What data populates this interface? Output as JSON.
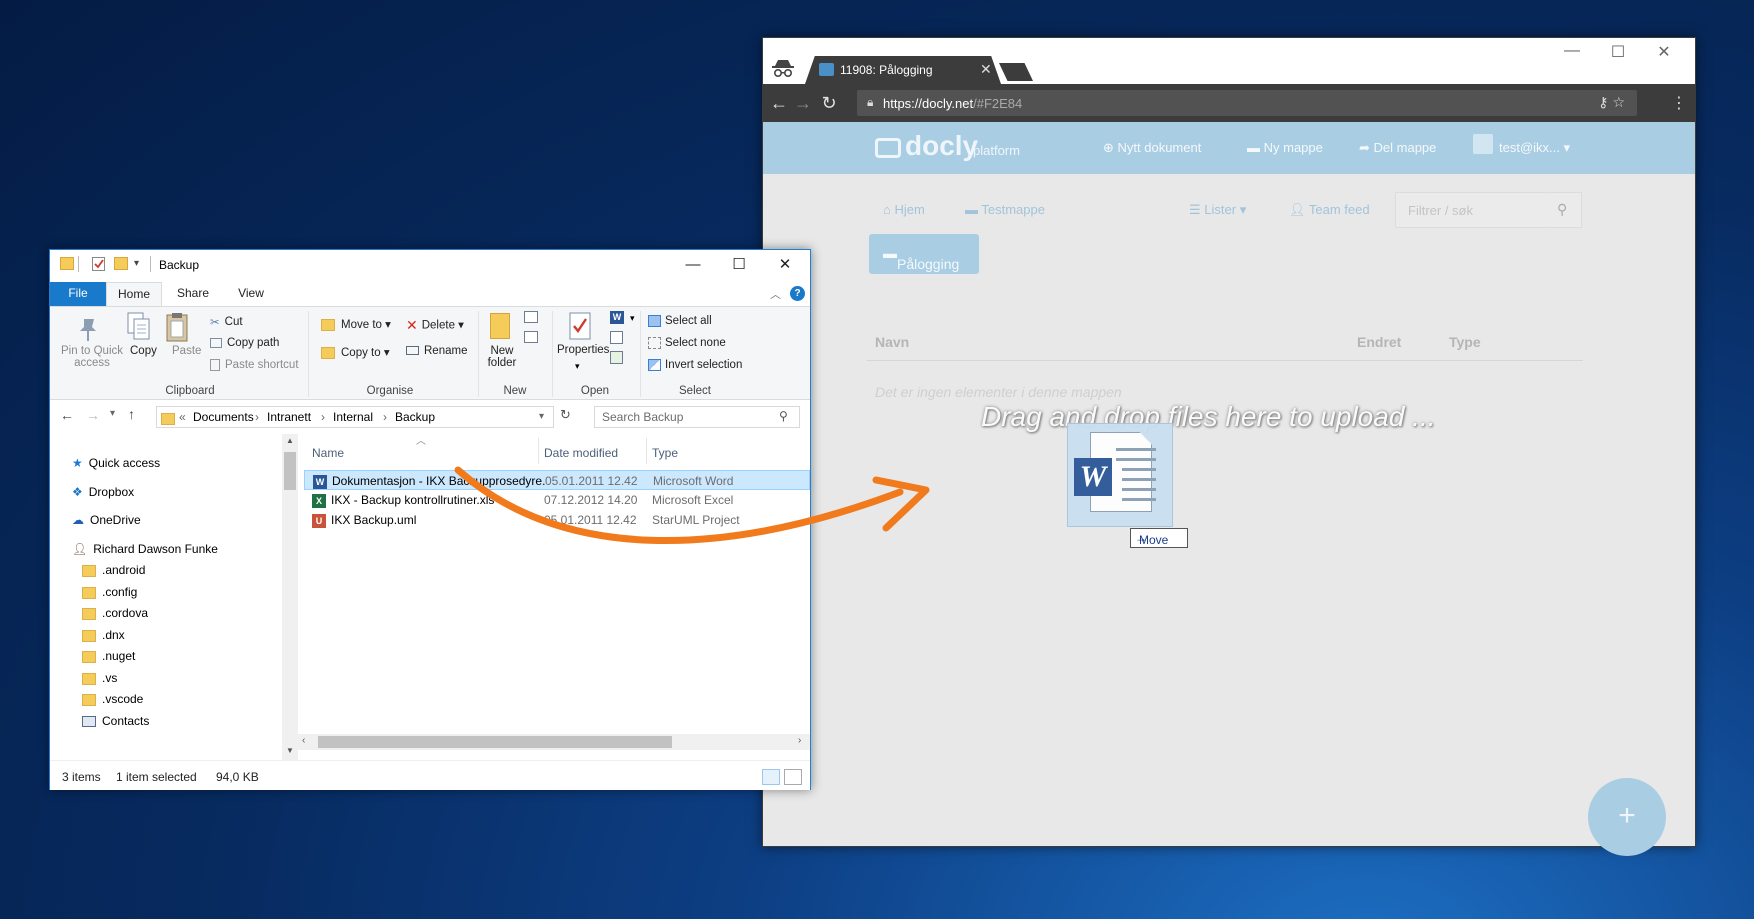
{
  "browser": {
    "tab_title": "11908: Pålogging",
    "tab_close": "✕",
    "url_prefix": "https://",
    "url_host": "docly.net",
    "url_path": "/#F2E84",
    "icons": [
      "incognito-icon",
      "back-icon",
      "forward-icon",
      "reload-icon",
      "lock-icon",
      "key-icon",
      "star-icon",
      "menu-icon"
    ]
  },
  "docly": {
    "logo": "docly",
    "logo_tagline": "platform",
    "header_nav": [
      "Nytt dokument",
      "Ny mappe",
      "Del mappe"
    ],
    "user": "test@ikx...",
    "subnav": [
      "Hjem",
      "Testmappe",
      "Lister",
      "Team feed"
    ],
    "filter_placeholder": "Filtrer / søk",
    "breadcrumb": "Pålogging",
    "table_headers": [
      "Navn",
      "Endret",
      "Type"
    ],
    "empty_message": "Det er ingen elementer i denne mappen",
    "drop_message": "Drag and drop files here to upload ...",
    "fab": "+",
    "brand_color": "#a9cde3"
  },
  "drag": {
    "label": "Move",
    "glyph": "W"
  },
  "explorer": {
    "title": "Backup",
    "tabs": [
      "File",
      "Home",
      "Share",
      "View"
    ],
    "ribbon": {
      "clipboard": {
        "label": "Clipboard",
        "pin": [
          "Pin to Quick",
          "access"
        ],
        "copy": "Copy",
        "paste": "Paste",
        "cut": "Cut",
        "copy_path": "Copy path",
        "paste_shortcut": "Paste shortcut"
      },
      "organise": {
        "label": "Organise",
        "move_to": "Move to",
        "copy_to": "Copy to",
        "delete": "Delete",
        "rename": "Rename"
      },
      "new": {
        "label": "New",
        "new_folder": [
          "New",
          "folder"
        ]
      },
      "open": {
        "label": "Open",
        "properties": "Properties"
      },
      "select": {
        "label": "Select",
        "select_all": "Select all",
        "select_none": "Select none",
        "invert": "Invert selection"
      }
    },
    "address": {
      "prefix": "«",
      "path": [
        "Documents",
        "Intranett",
        "Internal",
        "Backup"
      ],
      "search_placeholder": "Search Backup"
    },
    "tree": [
      {
        "label": "Quick access",
        "icon": "star-icon"
      },
      {
        "label": "Dropbox",
        "icon": "dropbox-icon"
      },
      {
        "label": "OneDrive",
        "icon": "cloud-icon"
      },
      {
        "label": "Richard Dawson Funke",
        "icon": "user-icon"
      },
      {
        "label": ".android",
        "icon": "folder-icon"
      },
      {
        "label": ".config",
        "icon": "folder-icon"
      },
      {
        "label": ".cordova",
        "icon": "folder-icon"
      },
      {
        "label": ".dnx",
        "icon": "folder-icon"
      },
      {
        "label": ".nuget",
        "icon": "folder-icon"
      },
      {
        "label": ".vs",
        "icon": "folder-icon"
      },
      {
        "label": ".vscode",
        "icon": "folder-icon"
      },
      {
        "label": "Contacts",
        "icon": "contacts-icon"
      }
    ],
    "columns": [
      "Name",
      "Date modified",
      "Type"
    ],
    "files": [
      {
        "name": "Dokumentasjon - IKX Backupprosedyre.d...",
        "date": "05.01.2011 12.42",
        "type": "Microsoft Word",
        "icon": "word-icon",
        "selected": true
      },
      {
        "name": "IKX - Backup kontrollrutiner.xls",
        "date": "07.12.2012 14.20",
        "type": "Microsoft Excel",
        "icon": "excel-icon",
        "selected": false
      },
      {
        "name": "IKX Backup.uml",
        "date": "05.01.2011 12.42",
        "type": "StarUML Project",
        "icon": "uml-icon",
        "selected": false
      }
    ],
    "status": {
      "items": "3 items",
      "selected": "1 item selected",
      "size": "94,0 KB"
    },
    "accent": "#1979ca"
  },
  "arrow_color": "#f07a1c"
}
